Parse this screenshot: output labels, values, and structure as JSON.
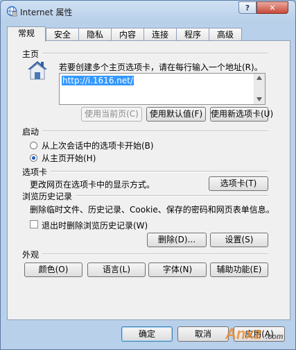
{
  "window": {
    "title": "Internet 属性",
    "help": "?",
    "close": "✕"
  },
  "tabs": [
    "常规",
    "安全",
    "隐私",
    "内容",
    "连接",
    "程序",
    "高级"
  ],
  "home": {
    "title": "主页",
    "description": "若要创建多个主页选项卡，请在每行输入一个地址(R)。",
    "url": "http://i.1616.net/",
    "use_current": "使用当前页(C)",
    "use_default": "使用默认值(F)",
    "use_new_tab": "使用新选项卡(U)"
  },
  "startup": {
    "title": "启动",
    "option1": "从上次会话中的选项卡开始(B)",
    "option2": "从主页开始(H)"
  },
  "tabs_section": {
    "title": "选项卡",
    "description": "更改网页在选项卡中的显示方式。",
    "button": "选项卡(T)"
  },
  "history": {
    "title": "浏览历史记录",
    "description": "删除临时文件、历史记录、Cookie、保存的密码和网页表单信息。",
    "checkbox": "退出时删除浏览历史记录(W)",
    "delete": "删除(D)...",
    "settings": "设置(S)"
  },
  "appearance": {
    "title": "外观",
    "colors": "颜色(O)",
    "languages": "语言(L)",
    "fonts": "字体(N)",
    "accessibility": "辅助功能(E)"
  },
  "footer": {
    "ok": "确定",
    "cancel": "取消",
    "apply": "应用(A)"
  },
  "watermark": {
    "brand": "Anxz",
    "suffix": ".com"
  }
}
